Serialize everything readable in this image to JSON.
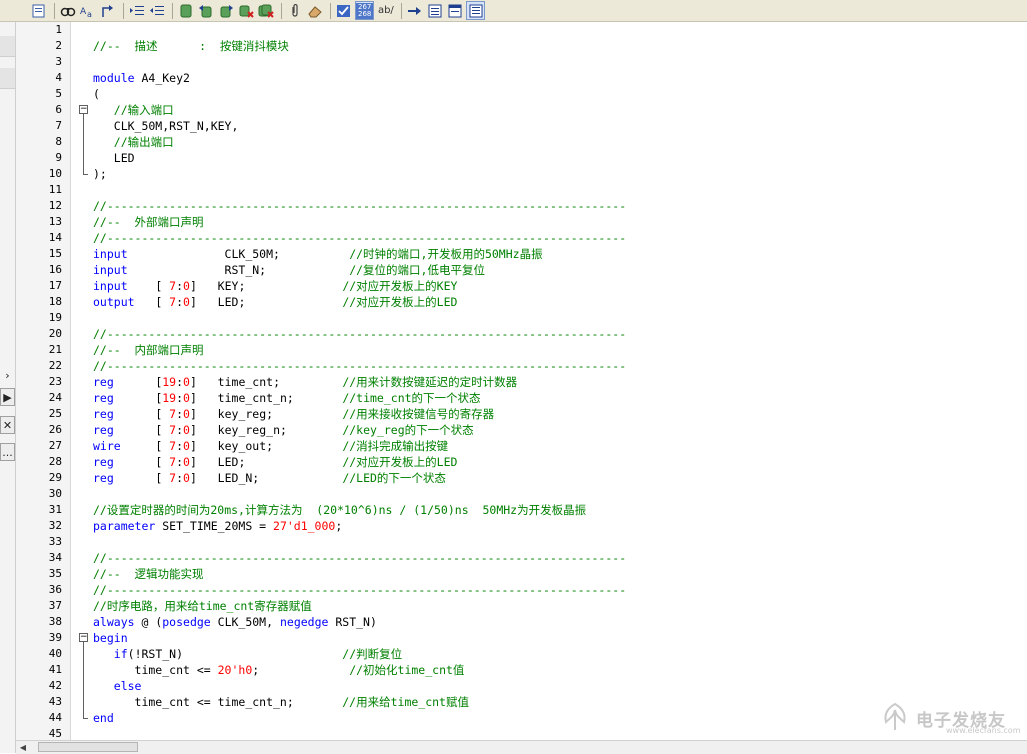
{
  "toolbar": {
    "buttons": [
      "new-file",
      "find",
      "replace-case",
      "goto",
      "indent",
      "outdent",
      "bookmark-toggle",
      "bookmark-prev",
      "bookmark-next",
      "bookmark-clear",
      "bookmark-clear-all",
      "attach",
      "eraser",
      "edit-check",
      "line-numbers",
      "word-wrap",
      "go-to",
      "show-space",
      "toggle-panel-a",
      "toggle-panel-b"
    ],
    "line_numbers_label_top": "267",
    "line_numbers_label_bottom": "268",
    "word_wrap_label": "ab/"
  },
  "left_panel": {
    "arrow_glyph": "›",
    "expand_glyph": "▶",
    "close_glyph": "✕",
    "dots_glyph": "..."
  },
  "line_numbers": [
    "1",
    "2",
    "3",
    "4",
    "5",
    "6",
    "7",
    "8",
    "9",
    "10",
    "11",
    "12",
    "13",
    "14",
    "15",
    "16",
    "17",
    "18",
    "19",
    "20",
    "21",
    "22",
    "23",
    "24",
    "25",
    "26",
    "27",
    "28",
    "29",
    "30",
    "31",
    "32",
    "33",
    "34",
    "35",
    "36",
    "37",
    "38",
    "39",
    "40",
    "41",
    "42",
    "43",
    "44",
    "45"
  ],
  "code_lines": [
    [],
    [
      {
        "t": "cm",
        "s": "//--  描述      :  按键消抖模块"
      }
    ],
    [],
    [
      {
        "t": "kw",
        "s": "module"
      },
      {
        "t": "tx",
        "s": " A4_Key2"
      }
    ],
    [
      {
        "t": "tx",
        "s": "("
      }
    ],
    [
      {
        "t": "cm",
        "s": "   //输入端口"
      }
    ],
    [
      {
        "t": "tx",
        "s": "   CLK_50M,RST_N,KEY,"
      }
    ],
    [
      {
        "t": "cm",
        "s": "   //输出端口"
      }
    ],
    [
      {
        "t": "tx",
        "s": "   LED"
      }
    ],
    [
      {
        "t": "tx",
        "s": ");"
      }
    ],
    [],
    [
      {
        "t": "cm",
        "s": "//---------------------------------------------------------------------------"
      }
    ],
    [
      {
        "t": "cm",
        "s": "//--  外部端口声明"
      }
    ],
    [
      {
        "t": "cm",
        "s": "//---------------------------------------------------------------------------"
      }
    ],
    [
      {
        "t": "kw",
        "s": "input"
      },
      {
        "t": "tx",
        "s": "              CLK_50M;          "
      },
      {
        "t": "cm",
        "s": "//时钟的端口,开发板用的50MHz晶振"
      }
    ],
    [
      {
        "t": "kw",
        "s": "input"
      },
      {
        "t": "tx",
        "s": "              RST_N;            "
      },
      {
        "t": "cm",
        "s": "//复位的端口,低电平复位"
      }
    ],
    [
      {
        "t": "kw",
        "s": "input"
      },
      {
        "t": "tx",
        "s": "    [ "
      },
      {
        "t": "num",
        "s": "7"
      },
      {
        "t": "tx",
        "s": ":"
      },
      {
        "t": "num",
        "s": "0"
      },
      {
        "t": "tx",
        "s": "]   KEY;              "
      },
      {
        "t": "cm",
        "s": "//对应开发板上的KEY"
      }
    ],
    [
      {
        "t": "kw",
        "s": "output"
      },
      {
        "t": "tx",
        "s": "   [ "
      },
      {
        "t": "num",
        "s": "7"
      },
      {
        "t": "tx",
        "s": ":"
      },
      {
        "t": "num",
        "s": "0"
      },
      {
        "t": "tx",
        "s": "]   LED;              "
      },
      {
        "t": "cm",
        "s": "//对应开发板上的LED"
      }
    ],
    [],
    [
      {
        "t": "cm",
        "s": "//---------------------------------------------------------------------------"
      }
    ],
    [
      {
        "t": "cm",
        "s": "//--  内部端口声明"
      }
    ],
    [
      {
        "t": "cm",
        "s": "//---------------------------------------------------------------------------"
      }
    ],
    [
      {
        "t": "kw",
        "s": "reg"
      },
      {
        "t": "tx",
        "s": "      ["
      },
      {
        "t": "num",
        "s": "19"
      },
      {
        "t": "tx",
        "s": ":"
      },
      {
        "t": "num",
        "s": "0"
      },
      {
        "t": "tx",
        "s": "]   time_cnt;         "
      },
      {
        "t": "cm",
        "s": "//用来计数按键延迟的定时计数器"
      }
    ],
    [
      {
        "t": "kw",
        "s": "reg"
      },
      {
        "t": "tx",
        "s": "      ["
      },
      {
        "t": "num",
        "s": "19"
      },
      {
        "t": "tx",
        "s": ":"
      },
      {
        "t": "num",
        "s": "0"
      },
      {
        "t": "tx",
        "s": "]   time_cnt_n;       "
      },
      {
        "t": "cm",
        "s": "//time_cnt的下一个状态"
      }
    ],
    [
      {
        "t": "kw",
        "s": "reg"
      },
      {
        "t": "tx",
        "s": "      [ "
      },
      {
        "t": "num",
        "s": "7"
      },
      {
        "t": "tx",
        "s": ":"
      },
      {
        "t": "num",
        "s": "0"
      },
      {
        "t": "tx",
        "s": "]   key_reg;          "
      },
      {
        "t": "cm",
        "s": "//用来接收按键信号的寄存器"
      }
    ],
    [
      {
        "t": "kw",
        "s": "reg"
      },
      {
        "t": "tx",
        "s": "      [ "
      },
      {
        "t": "num",
        "s": "7"
      },
      {
        "t": "tx",
        "s": ":"
      },
      {
        "t": "num",
        "s": "0"
      },
      {
        "t": "tx",
        "s": "]   key_reg_n;        "
      },
      {
        "t": "cm",
        "s": "//key_reg的下一个状态"
      }
    ],
    [
      {
        "t": "kw",
        "s": "wire"
      },
      {
        "t": "tx",
        "s": "     [ "
      },
      {
        "t": "num",
        "s": "7"
      },
      {
        "t": "tx",
        "s": ":"
      },
      {
        "t": "num",
        "s": "0"
      },
      {
        "t": "tx",
        "s": "]   key_out;          "
      },
      {
        "t": "cm",
        "s": "//消抖完成输出按键"
      }
    ],
    [
      {
        "t": "kw",
        "s": "reg"
      },
      {
        "t": "tx",
        "s": "      [ "
      },
      {
        "t": "num",
        "s": "7"
      },
      {
        "t": "tx",
        "s": ":"
      },
      {
        "t": "num",
        "s": "0"
      },
      {
        "t": "tx",
        "s": "]   LED;              "
      },
      {
        "t": "cm",
        "s": "//对应开发板上的LED"
      }
    ],
    [
      {
        "t": "kw",
        "s": "reg"
      },
      {
        "t": "tx",
        "s": "      [ "
      },
      {
        "t": "num",
        "s": "7"
      },
      {
        "t": "tx",
        "s": ":"
      },
      {
        "t": "num",
        "s": "0"
      },
      {
        "t": "tx",
        "s": "]   LED_N;            "
      },
      {
        "t": "cm",
        "s": "//LED的下一个状态"
      }
    ],
    [],
    [
      {
        "t": "cm",
        "s": "//设置定时器的时间为20ms,计算方法为  (20*10^6)ns / (1/50)ns  50MHz为开发板晶振"
      }
    ],
    [
      {
        "t": "kw",
        "s": "parameter"
      },
      {
        "t": "tx",
        "s": " SET_TIME_20MS = "
      },
      {
        "t": "num",
        "s": "27'd1_000"
      },
      {
        "t": "tx",
        "s": ";"
      }
    ],
    [],
    [
      {
        "t": "cm",
        "s": "//---------------------------------------------------------------------------"
      }
    ],
    [
      {
        "t": "cm",
        "s": "//--  逻辑功能实现"
      }
    ],
    [
      {
        "t": "cm",
        "s": "//---------------------------------------------------------------------------"
      }
    ],
    [
      {
        "t": "cm",
        "s": "//时序电路，用来给time_cnt寄存器赋值"
      }
    ],
    [
      {
        "t": "kw",
        "s": "always"
      },
      {
        "t": "tx",
        "s": " @ ("
      },
      {
        "t": "kw",
        "s": "posedge"
      },
      {
        "t": "tx",
        "s": " CLK_50M, "
      },
      {
        "t": "kw",
        "s": "negedge"
      },
      {
        "t": "tx",
        "s": " RST_N)"
      }
    ],
    [
      {
        "t": "kw",
        "s": "begin"
      }
    ],
    [
      {
        "t": "tx",
        "s": "   "
      },
      {
        "t": "kw",
        "s": "if"
      },
      {
        "t": "tx",
        "s": "(!RST_N)                       "
      },
      {
        "t": "cm",
        "s": "//判断复位"
      }
    ],
    [
      {
        "t": "tx",
        "s": "      time_cnt <= "
      },
      {
        "t": "num",
        "s": "20'h0"
      },
      {
        "t": "tx",
        "s": ";             "
      },
      {
        "t": "cm",
        "s": "//初始化time_cnt值"
      }
    ],
    [
      {
        "t": "tx",
        "s": "   "
      },
      {
        "t": "kw",
        "s": "else"
      }
    ],
    [
      {
        "t": "tx",
        "s": "      time_cnt <= time_cnt_n;       "
      },
      {
        "t": "cm",
        "s": "//用来给time_cnt赋值"
      }
    ],
    [
      {
        "t": "kw",
        "s": "end"
      }
    ],
    []
  ],
  "folds": [
    {
      "start": 6,
      "end": 10
    },
    {
      "start": 39,
      "end": 44
    }
  ],
  "watermark": {
    "big": "电子发烧友",
    "small": "www.elecfans.com"
  },
  "colors": {
    "keyword": "#0000ff",
    "comment": "#008000",
    "number": "#ff0000",
    "text": "#000000"
  }
}
